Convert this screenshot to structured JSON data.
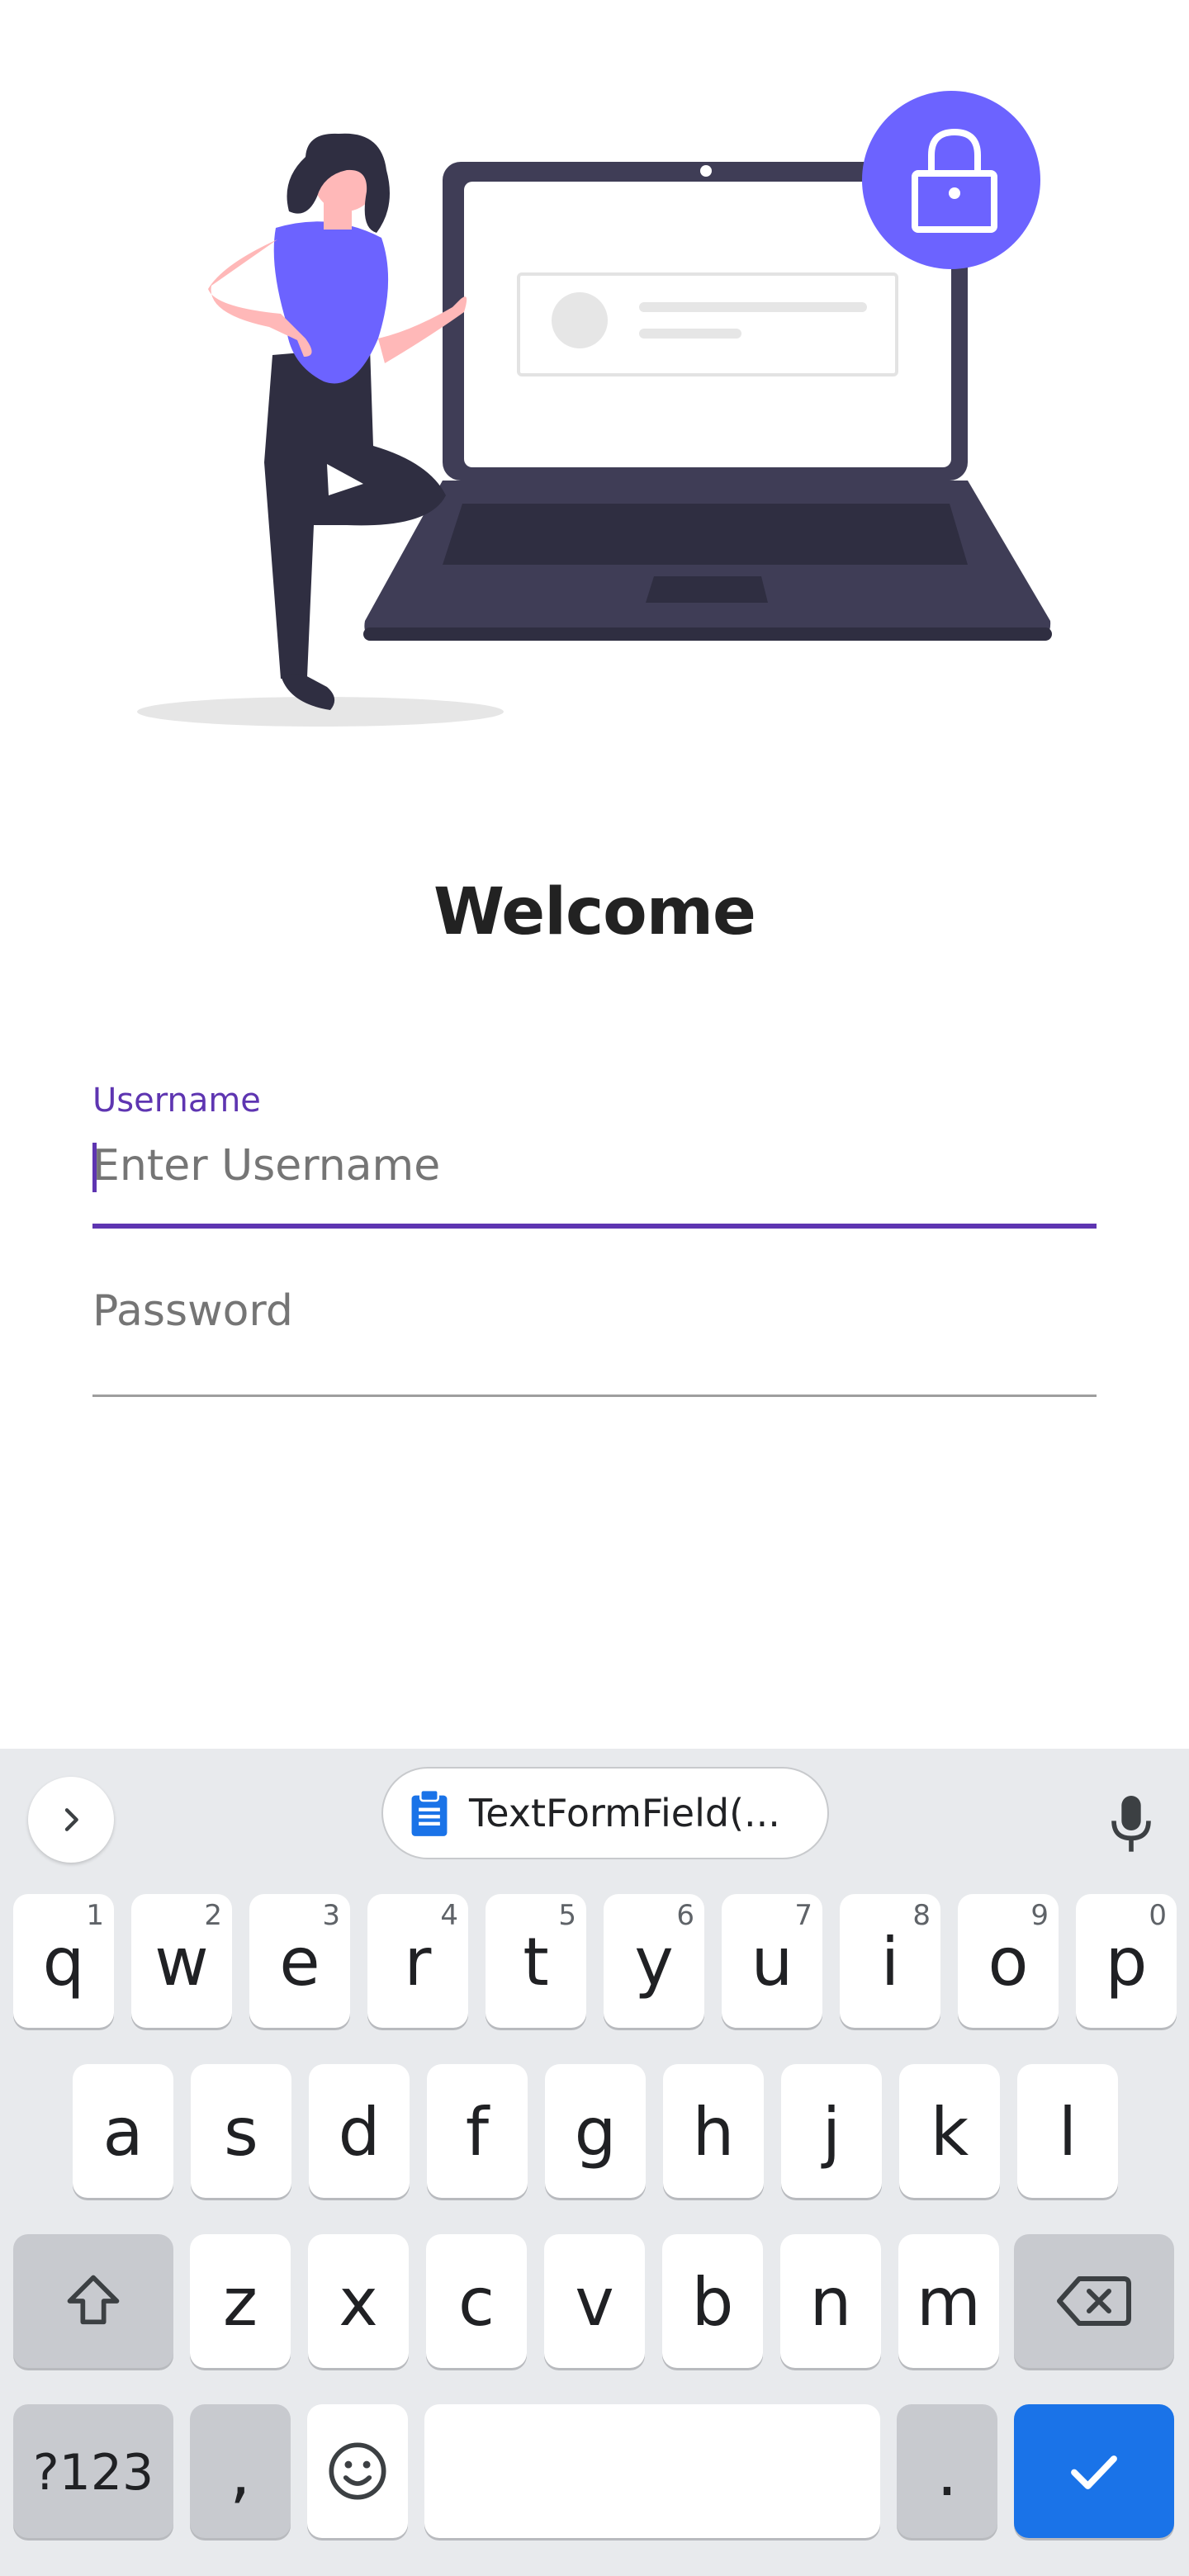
{
  "welcome_title": "Welcome",
  "username": {
    "floating_label": "Username",
    "placeholder": "Enter Username",
    "value": ""
  },
  "password": {
    "placeholder": "Password",
    "value": ""
  },
  "keyboard": {
    "toolbar": {
      "expand_icon": "chevron-right-icon",
      "clipboard_icon": "clipboard-icon",
      "clipboard_suggestion": "TextFormField(...",
      "mic_icon": "microphone-icon"
    },
    "row1": [
      {
        "key": "q",
        "hint": "1"
      },
      {
        "key": "w",
        "hint": "2"
      },
      {
        "key": "e",
        "hint": "3"
      },
      {
        "key": "r",
        "hint": "4"
      },
      {
        "key": "t",
        "hint": "5"
      },
      {
        "key": "y",
        "hint": "6"
      },
      {
        "key": "u",
        "hint": "7"
      },
      {
        "key": "i",
        "hint": "8"
      },
      {
        "key": "o",
        "hint": "9"
      },
      {
        "key": "p",
        "hint": "0"
      }
    ],
    "row2": [
      "a",
      "s",
      "d",
      "f",
      "g",
      "h",
      "j",
      "k",
      "l"
    ],
    "row3": [
      "z",
      "x",
      "c",
      "v",
      "b",
      "n",
      "m"
    ],
    "symbols_label": "?123",
    "comma_label": ",",
    "period_label": ".",
    "shift_icon": "shift-icon",
    "backspace_icon": "backspace-icon",
    "emoji_icon": "emoji-icon",
    "enter_icon": "check-icon"
  },
  "colors": {
    "accent": "#5e35b1",
    "illustration_purple": "#6c63ff",
    "illustration_dark": "#3f3d56",
    "keyboard_bg": "#e8eaed",
    "action_key": "#1a73e8"
  }
}
